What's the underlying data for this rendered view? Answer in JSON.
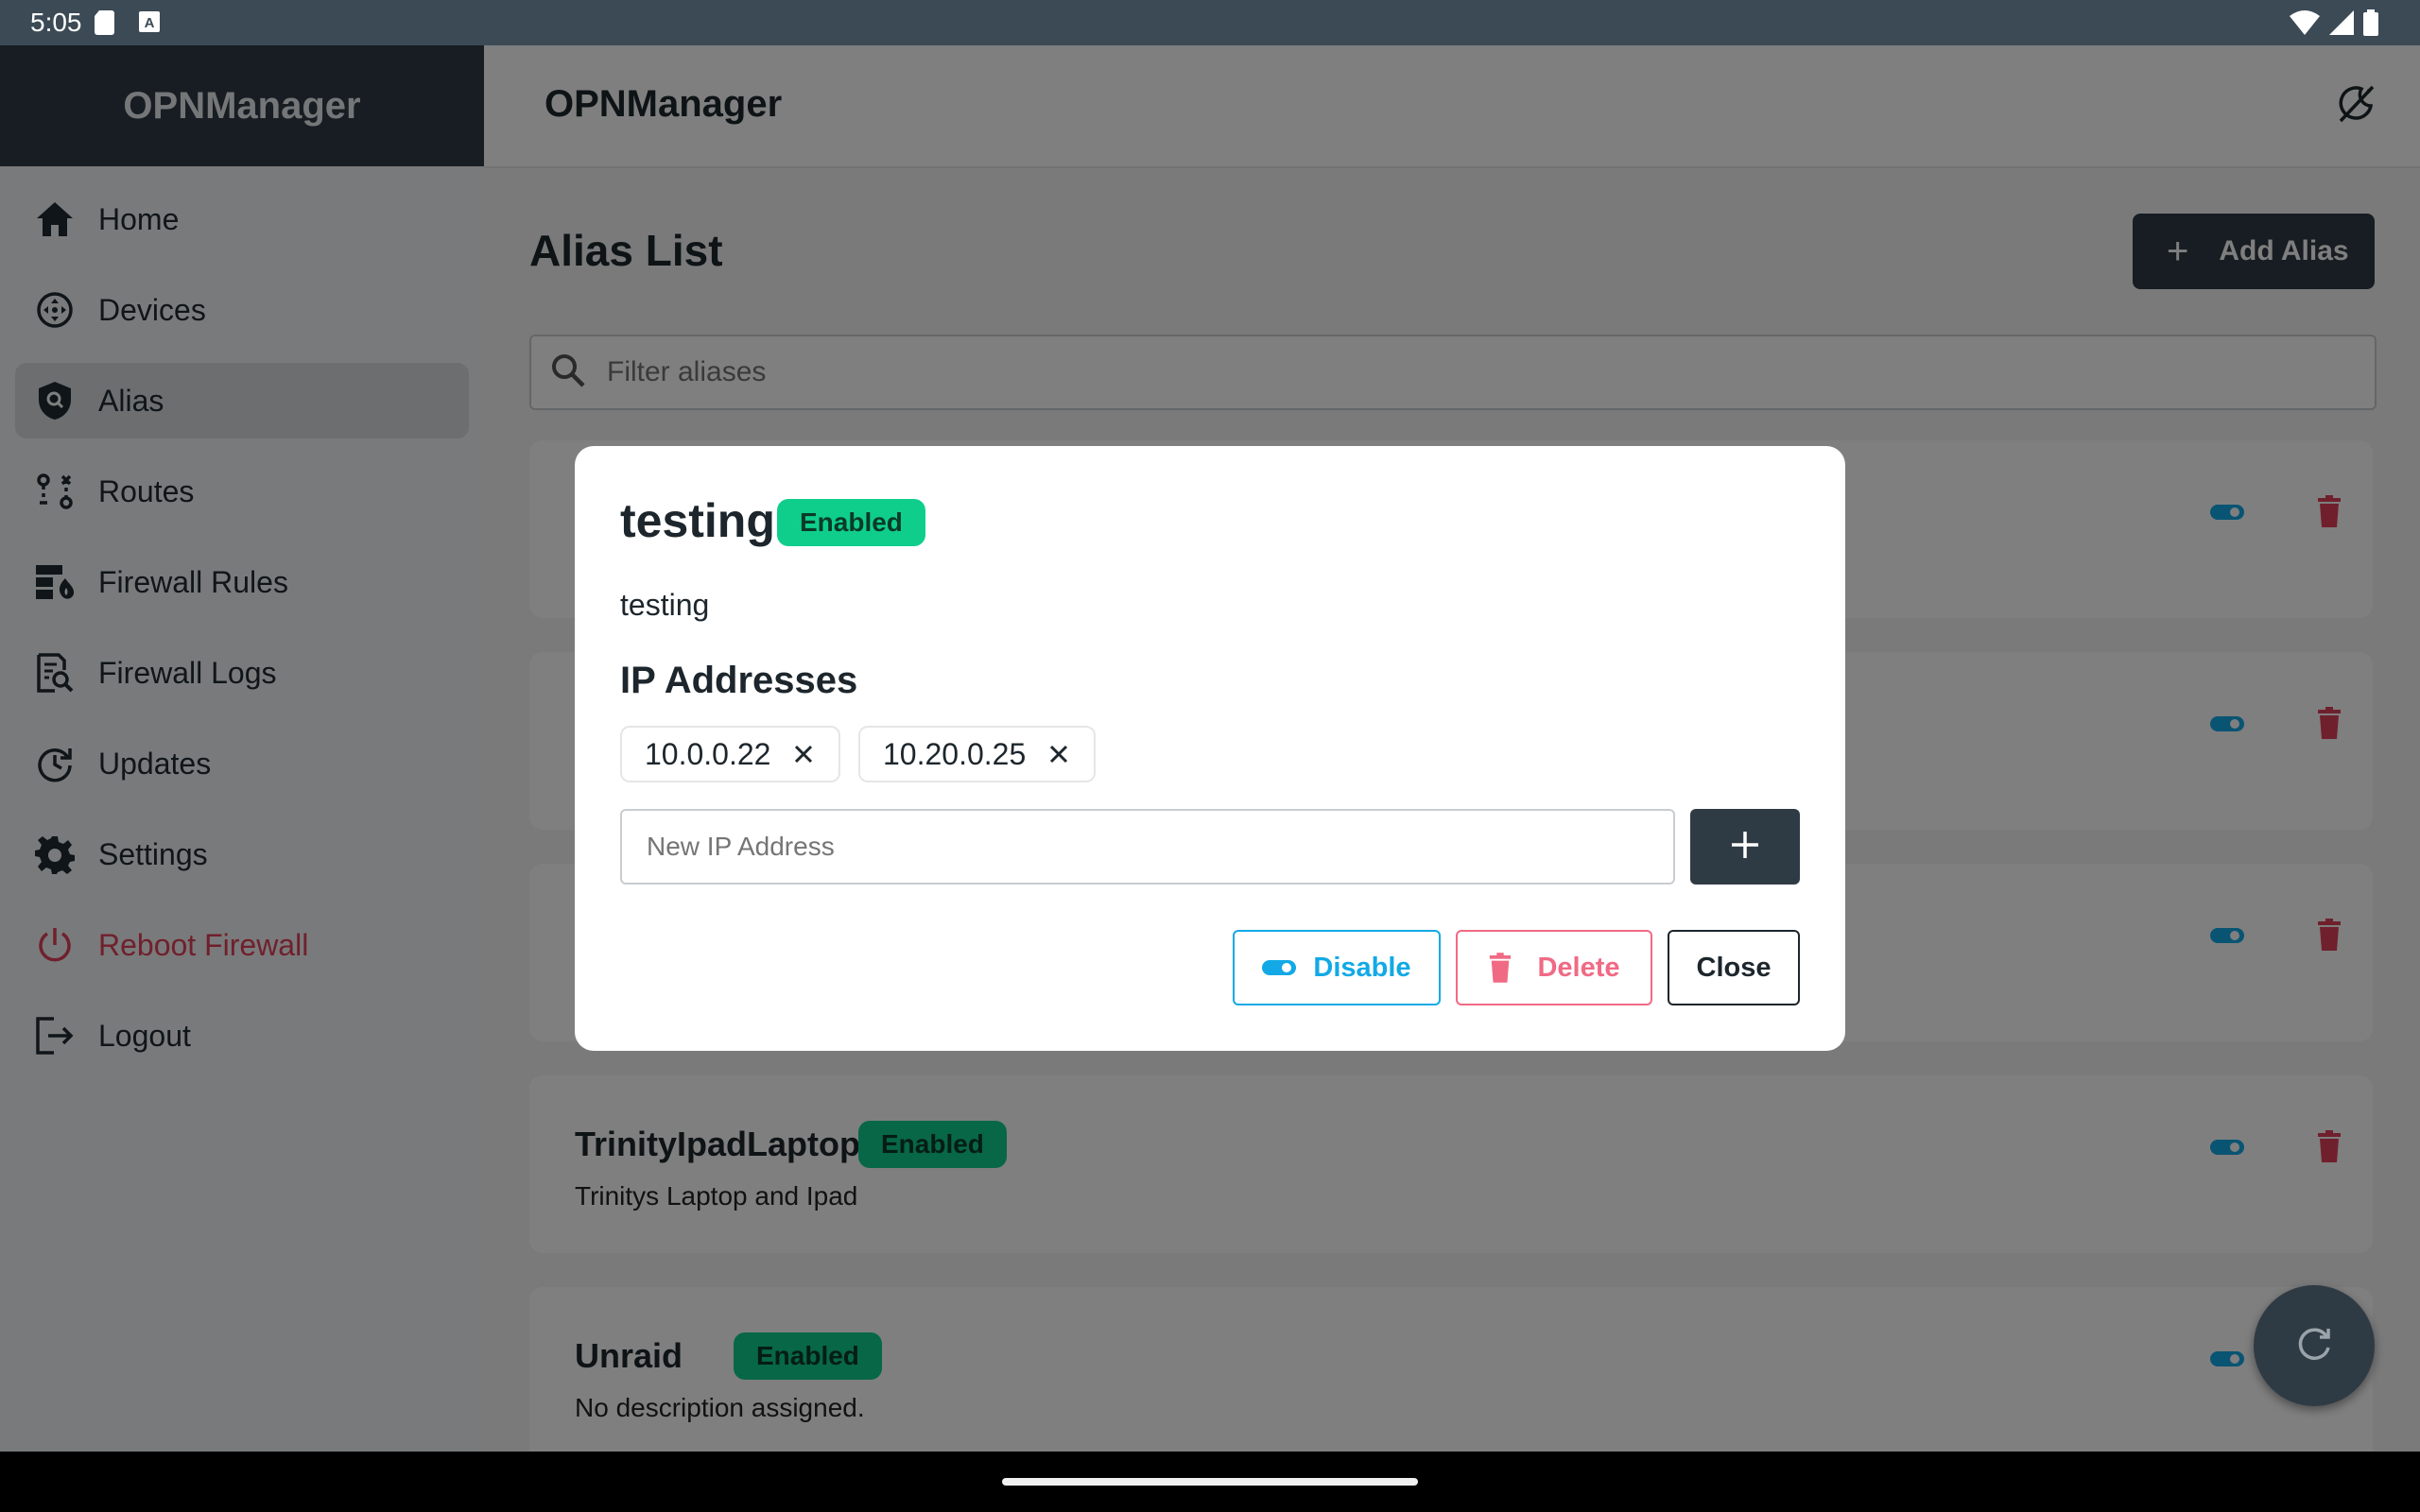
{
  "status_bar": {
    "time": "5:05"
  },
  "sidebar": {
    "brand": "OPNManager",
    "items": [
      {
        "label": "Home",
        "icon": "home-icon"
      },
      {
        "label": "Devices",
        "icon": "devices-icon"
      },
      {
        "label": "Alias",
        "icon": "alias-shield-icon"
      },
      {
        "label": "Routes",
        "icon": "routes-icon"
      },
      {
        "label": "Firewall Rules",
        "icon": "firewall-rules-icon"
      },
      {
        "label": "Firewall Logs",
        "icon": "firewall-logs-icon"
      },
      {
        "label": "Updates",
        "icon": "updates-icon"
      },
      {
        "label": "Settings",
        "icon": "gear-icon"
      },
      {
        "label": "Reboot Firewall",
        "icon": "power-icon"
      },
      {
        "label": "Logout",
        "icon": "logout-icon"
      }
    ],
    "active": "Alias"
  },
  "app_bar": {
    "title": "OPNManager"
  },
  "main": {
    "title": "Alias List",
    "add_button": "Add Alias",
    "filter_placeholder": "Filter aliases",
    "cards": [
      {
        "title": "TrinityIpadLaptop",
        "status": "Enabled",
        "description": "Trinitys Laptop and Ipad"
      },
      {
        "title": "Unraid",
        "status": "Enabled",
        "description": "No description assigned."
      }
    ]
  },
  "dialog": {
    "title": "testing",
    "status": "Enabled",
    "description": "testing",
    "section_title": "IP Addresses",
    "ips": [
      "10.0.0.22",
      "10.20.0.25"
    ],
    "new_ip_placeholder": "New IP Address",
    "buttons": {
      "disable": "Disable",
      "delete": "Delete",
      "close": "Close"
    }
  },
  "colors": {
    "accent_dark": "#2f3b44",
    "enabled_badge": "#0fce8c",
    "toggle_blue": "#12a9e6",
    "delete_red": "#e0405a"
  }
}
